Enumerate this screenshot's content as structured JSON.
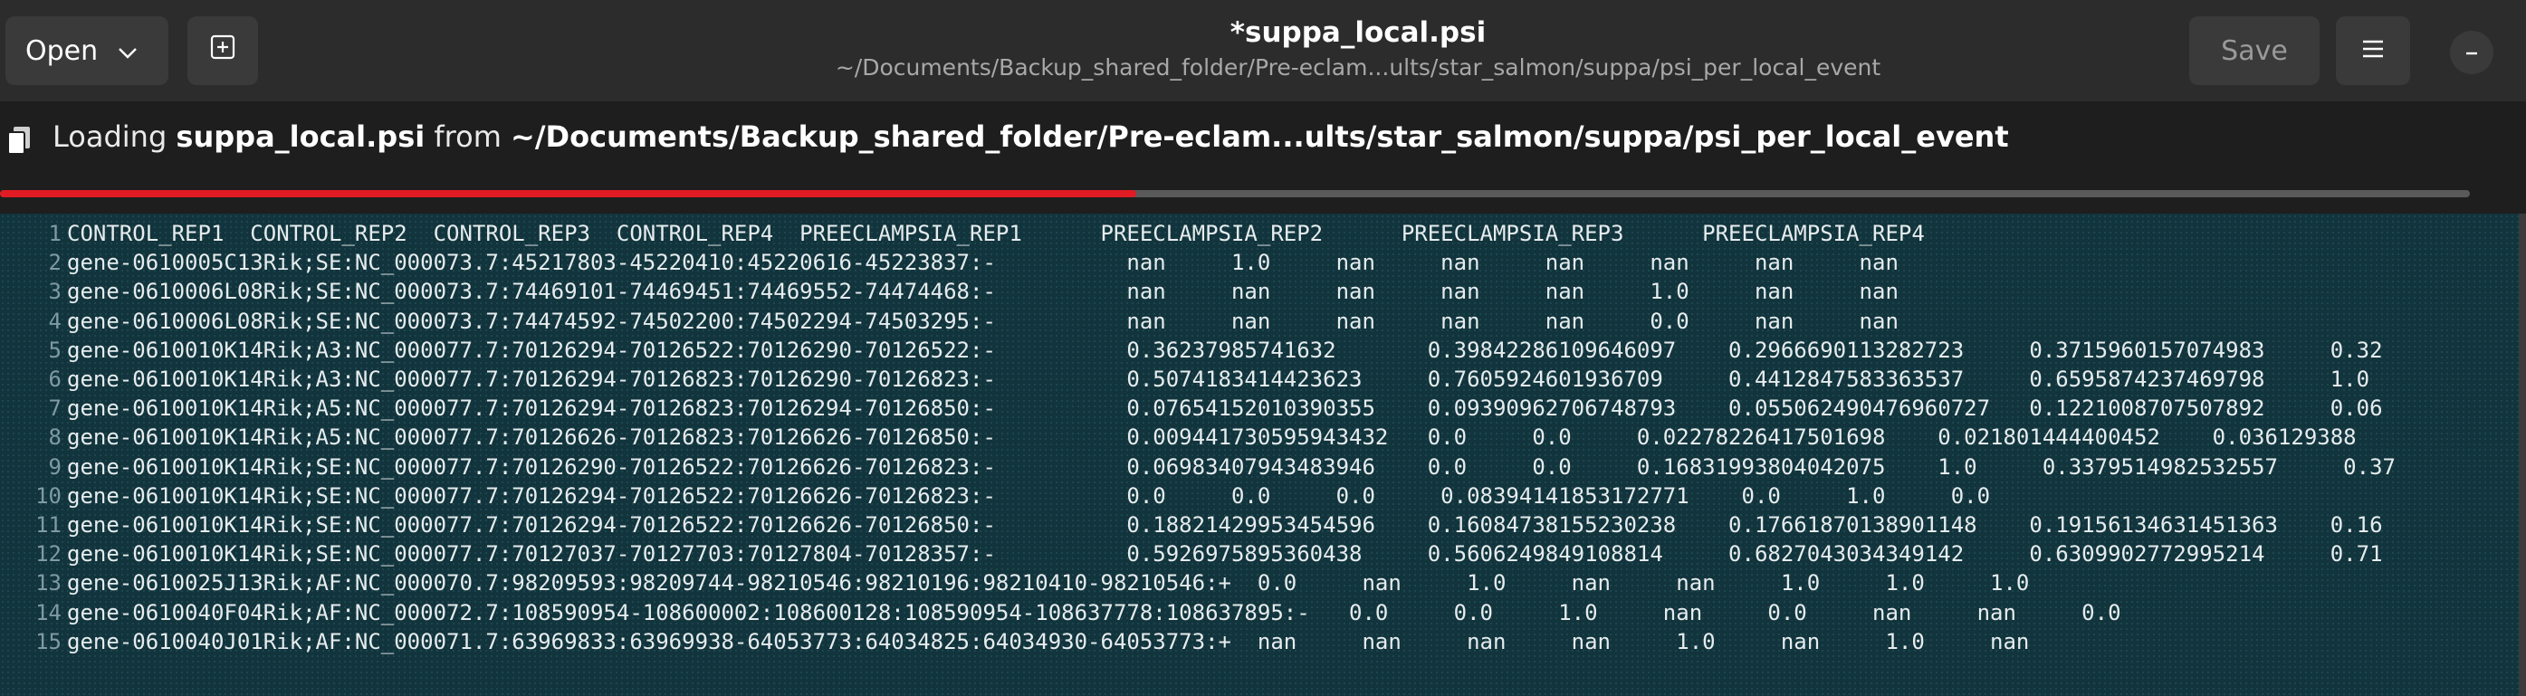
{
  "header": {
    "open_label": "Open",
    "title": "*suppa_local.psi",
    "path": "~/Documents/Backup_shared_folder/Pre-eclam...ults/star_salmon/suppa/psi_per_local_event",
    "save_label": "Save"
  },
  "infobar": {
    "prefix": "Loading",
    "filename": "suppa_local.psi",
    "middle": "from",
    "path": "~/Documents/Backup_shared_folder/Pre-eclam...ults/star_salmon/suppa/psi_per_local_event",
    "progress": 0.46
  },
  "editor": {
    "lines": [
      {
        "n": "1",
        "text": "CONTROL_REP1  CONTROL_REP2  CONTROL_REP3  CONTROL_REP4  PREECLAMPSIA_REP1      PREECLAMPSIA_REP2      PREECLAMPSIA_REP3      PREECLAMPSIA_REP4"
      },
      {
        "n": "2",
        "text": "gene-0610005C13Rik;SE:NC_000073.7:45217803-45220410:45220616-45223837:-          nan     1.0     nan     nan     nan     nan     nan     nan"
      },
      {
        "n": "3",
        "text": "gene-0610006L08Rik;SE:NC_000073.7:74469101-74469451:74469552-74474468:-          nan     nan     nan     nan     nan     1.0     nan     nan"
      },
      {
        "n": "4",
        "text": "gene-0610006L08Rik;SE:NC_000073.7:74474592-74502200:74502294-74503295:-          nan     nan     nan     nan     nan     0.0     nan     nan"
      },
      {
        "n": "5",
        "text": "gene-0610010K14Rik;A3:NC_000077.7:70126294-70126522:70126290-70126522:-          0.36237985741632       0.39842286109646097    0.2966690113282723     0.3715960157074983     0.32"
      },
      {
        "n": "6",
        "text": "gene-0610010K14Rik;A3:NC_000077.7:70126294-70126823:70126290-70126823:-          0.5074183414423623     0.7605924601936709     0.4412847583363537     0.6595874237469798     1.0"
      },
      {
        "n": "7",
        "text": "gene-0610010K14Rik;A5:NC_000077.7:70126294-70126823:70126294-70126850:-          0.07654152010390355    0.09390962706748793    0.055062490476960727   0.1221008707507892     0.06"
      },
      {
        "n": "8",
        "text": "gene-0610010K14Rik;A5:NC_000077.7:70126626-70126823:70126626-70126850:-          0.009441730595943432   0.0     0.0     0.02278226417501698    0.021801444400452    0.036129388"
      },
      {
        "n": "9",
        "text": "gene-0610010K14Rik;SE:NC_000077.7:70126290-70126522:70126626-70126823:-          0.06983407943483946    0.0     0.0     0.16831993804042075    1.0     0.3379514982532557     0.37"
      },
      {
        "n": "10",
        "text": "gene-0610010K14Rik;SE:NC_000077.7:70126294-70126522:70126626-70126823:-          0.0     0.0     0.0     0.08394141853172771    0.0     1.0     0.0"
      },
      {
        "n": "11",
        "text": "gene-0610010K14Rik;SE:NC_000077.7:70126294-70126522:70126626-70126850:-          0.18821429953454596    0.16084738155230238    0.17661870138901148    0.19156134631451363    0.16"
      },
      {
        "n": "12",
        "text": "gene-0610010K14Rik;SE:NC_000077.7:70127037-70127703:70127804-70128357:-          0.5926975895360438     0.5606249849108814     0.6827043034349142     0.6309902772995214     0.71"
      },
      {
        "n": "13",
        "text": "gene-0610025J13Rik;AF:NC_000070.7:98209593:98209744-98210546:98210196:98210410-98210546:+  0.0     nan     1.0     nan     nan     1.0     1.0     1.0"
      },
      {
        "n": "14",
        "text": "gene-0610040F04Rik;AF:NC_000072.7:108590954-108600002:108600128:108590954-108637778:108637895:-   0.0     0.0     1.0     nan     0.0     nan     nan     0.0"
      },
      {
        "n": "15",
        "text": "gene-0610040J01Rik;AF:NC_000071.7:63969833:63969938-64053773:64034825:64034930-64053773:+  nan     nan     nan     nan     1.0     nan     1.0     nan"
      }
    ]
  }
}
